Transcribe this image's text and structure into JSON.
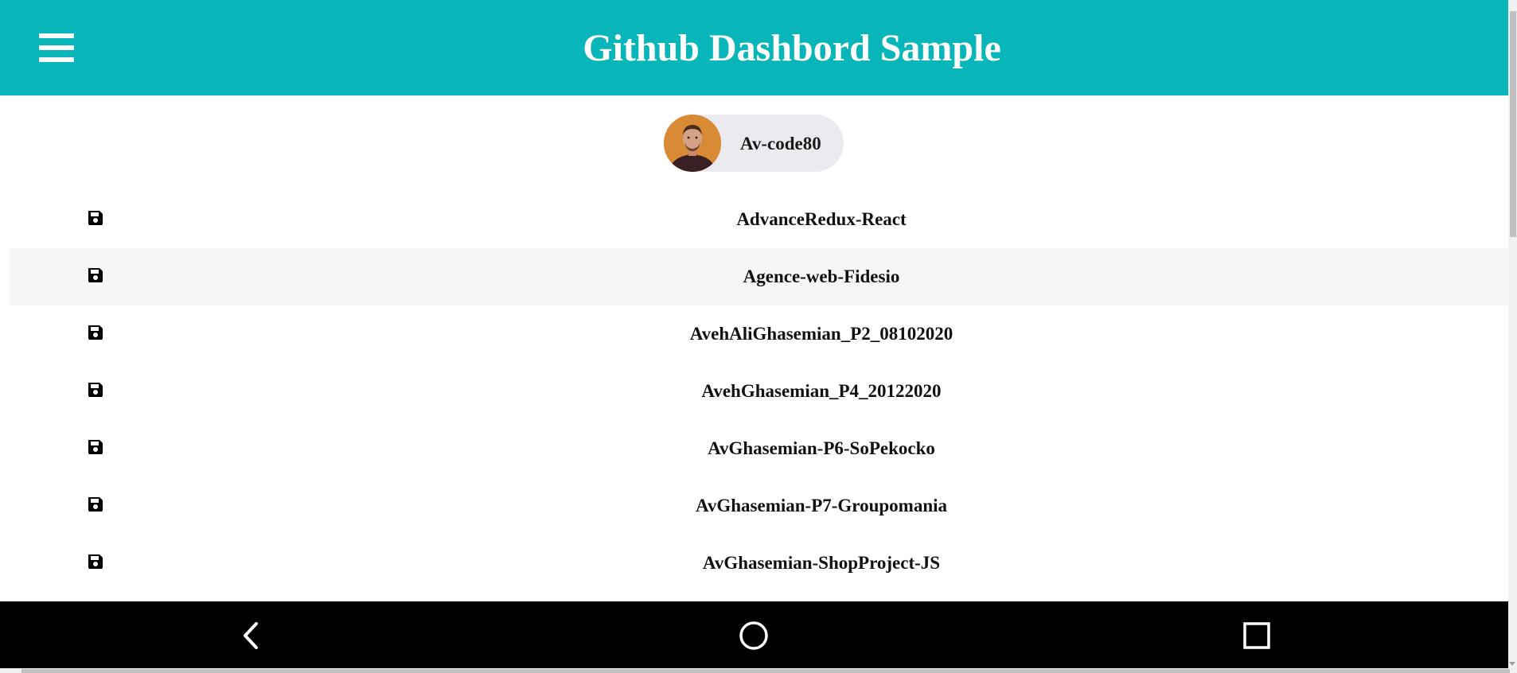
{
  "header": {
    "title": "Github Dashbord Sample",
    "menu_icon": "hamburger-menu-icon",
    "background": "#08b5b9"
  },
  "user": {
    "name": "Av-code80",
    "avatar_icon": "user-avatar"
  },
  "repos": [
    {
      "name": "AdvanceRedux-React",
      "icon": "save-icon"
    },
    {
      "name": "Agence-web-Fidesio",
      "icon": "save-icon"
    },
    {
      "name": "AvehAliGhasemian_P2_08102020",
      "icon": "save-icon"
    },
    {
      "name": "AvehGhasemian_P4_20122020",
      "icon": "save-icon"
    },
    {
      "name": "AvGhasemian-P6-SoPekocko",
      "icon": "save-icon"
    },
    {
      "name": "AvGhasemian-P7-Groupomania",
      "icon": "save-icon"
    },
    {
      "name": "AvGhasemian-ShopProject-JS",
      "icon": "save-icon"
    }
  ],
  "navbar": {
    "buttons": [
      "back-icon",
      "home-icon",
      "recent-apps-icon"
    ]
  }
}
